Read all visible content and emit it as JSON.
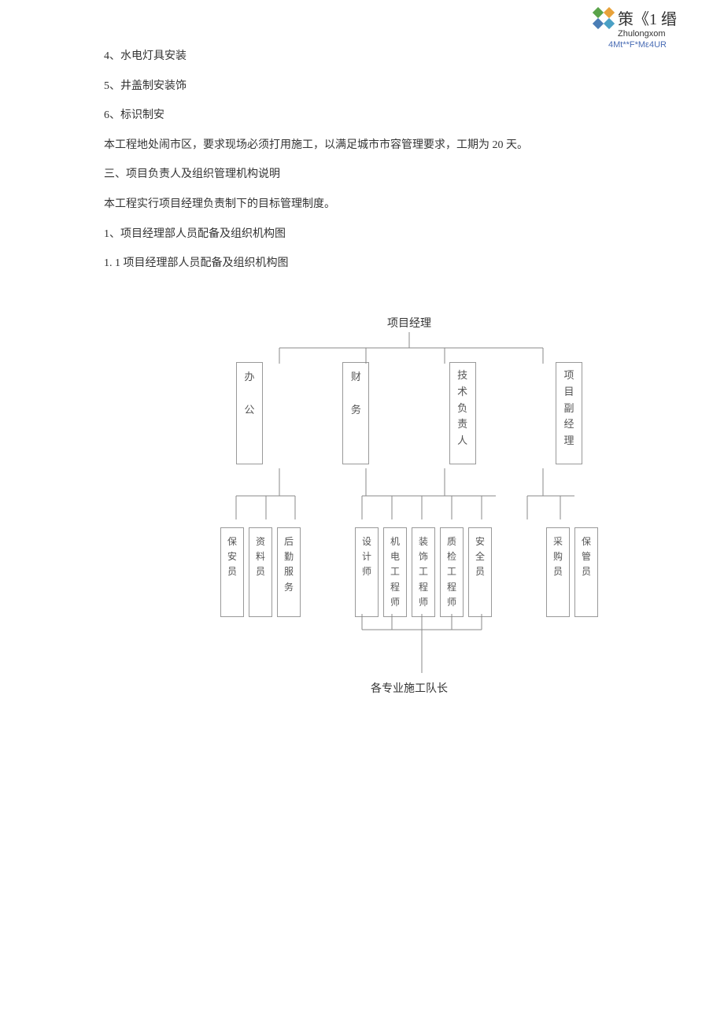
{
  "header": {
    "title": "策《1 缗",
    "subtitle": "Zhulongxom",
    "code": "4Mt**F*Mε4UR"
  },
  "body": {
    "p1": "4、水电灯具安装",
    "p2": "5、井盖制安装饰",
    "p3": "6、标识制安",
    "p4": "本工程地处闹市区，要求现场必须打用施工，以满足城市市容管理要求，工期为 20 天。",
    "p5": "三、项目负责人及组织管理机构说明",
    "p6": "本工程实行项目经理负责制下的目标管理制度。",
    "p7": "1、项目经理部人员配备及组织机构图",
    "p8": "1.  1 项目经理部人员配备及组织机构图"
  },
  "chart": {
    "top": "项目经理",
    "level2": [
      "办公",
      "财务",
      "技术负责人",
      "项目副经理"
    ],
    "level3_group1": [
      "保安员",
      "资料员",
      "后勤服务"
    ],
    "level3_group2": [
      "设计师",
      "机电工程师",
      "装饰工程师",
      "质检工程师",
      "安全员"
    ],
    "level3_group3": [
      "采购员",
      "保管员"
    ],
    "bottom": "各专业施工队长"
  }
}
